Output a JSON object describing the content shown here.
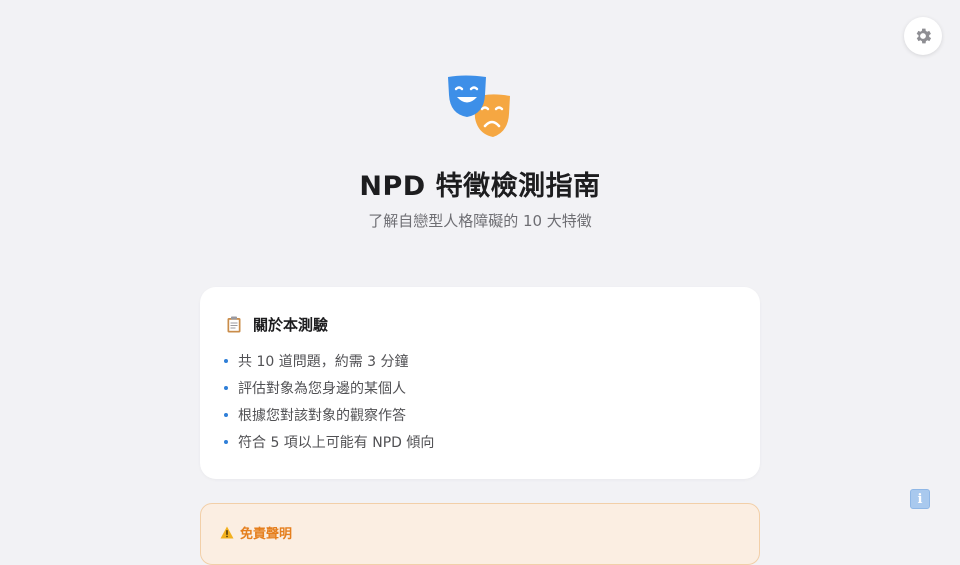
{
  "header": {
    "settings_icon": "gear-icon",
    "hero_icon": "theater-masks-icon",
    "title": "NPD 特徵檢測指南",
    "subtitle": "了解自戀型人格障礙的 10 大特徵"
  },
  "about_card": {
    "icon": "clipboard-icon",
    "title": "關於本測驗",
    "items": [
      "共 10 道問題，約需 3 分鐘",
      "評估對象為您身邊的某個人",
      "根據您對該對象的觀察作答",
      "符合 5 項以上可能有 NPD 傾向"
    ]
  },
  "disclaimer": {
    "icon": "warning-icon",
    "title": "免責聲明"
  },
  "floating": {
    "info_icon": "info-icon",
    "glyph": "i"
  },
  "colors": {
    "background": "#f2f2f5",
    "bullet": "#2f7fd8",
    "warning_text": "#e57f1e",
    "warning_bg": "#fbeee2",
    "mask_happy": "#3d8fe8",
    "mask_sad": "#f5a742"
  }
}
